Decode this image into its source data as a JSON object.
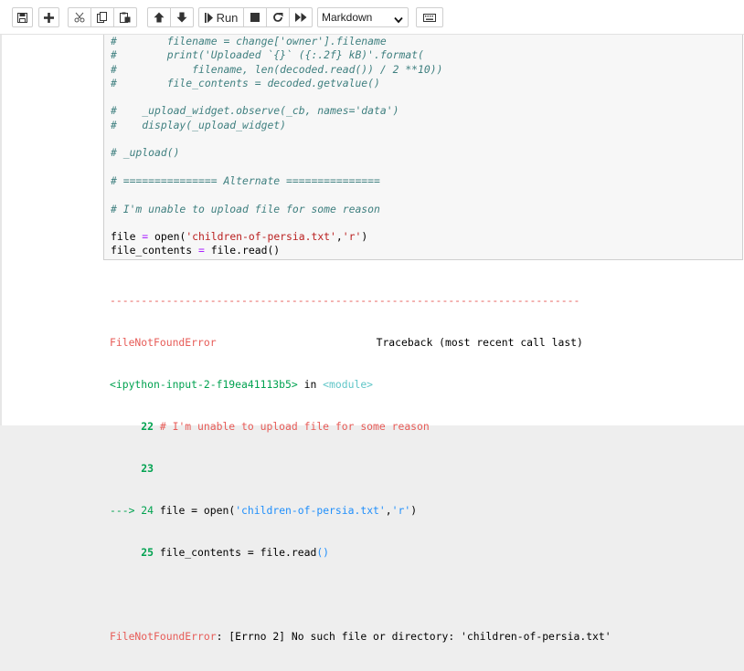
{
  "toolbar": {
    "run_label": "Run",
    "cell_type_value": "Markdown"
  },
  "code_lines": [
    {
      "type": "comment",
      "text": "#        filename = change['owner'].filename"
    },
    {
      "type": "comment",
      "text": "#        print('Uploaded `{}` ({:.2f} kB)'.format("
    },
    {
      "type": "comment",
      "text": "#            filename, len(decoded.read()) / 2 **10))"
    },
    {
      "type": "comment",
      "text": "#        file_contents = decoded.getvalue()"
    },
    {
      "type": "blank",
      "text": ""
    },
    {
      "type": "comment",
      "text": "#    _upload_widget.observe(_cb, names='data')"
    },
    {
      "type": "comment",
      "text": "#    display(_upload_widget)"
    },
    {
      "type": "blank",
      "text": ""
    },
    {
      "type": "comment",
      "text": "# _upload()"
    },
    {
      "type": "blank",
      "text": ""
    },
    {
      "type": "comment",
      "text": "# =============== Alternate ==============="
    },
    {
      "type": "blank",
      "text": ""
    },
    {
      "type": "comment",
      "text": "# I'm unable to upload file for some reason"
    },
    {
      "type": "blank",
      "text": ""
    },
    {
      "type": "code1",
      "parts": [
        "file ",
        "=",
        " open(",
        "'children-of-persia.txt'",
        ",",
        "'r'",
        ")"
      ]
    },
    {
      "type": "code2",
      "parts": [
        "file_contents ",
        "=",
        " file.read()"
      ]
    }
  ],
  "traceback": {
    "dashes": "---------------------------------------------------------------------------",
    "error_name": "FileNotFoundError",
    "traceback_label": "Traceback (most recent call last)",
    "input_ref": "<ipython-input-2-f19ea41113b5>",
    "in_text": " in ",
    "module_text": "<module>",
    "line22_num": "22",
    "line22_text": "# I'm unable to upload file for some reason",
    "line23_num": "23",
    "arrow": "--->",
    "line24_num": "24",
    "line24_pre": "file ",
    "line24_eq": "=",
    "line24_open": " open(",
    "line24_str1": "'children-of-persia.txt'",
    "line24_comma": ",",
    "line24_str2": "'r'",
    "line24_close": ")",
    "line25_num": "25",
    "line25_pre": "file_contents ",
    "line25_eq": "=",
    "line25_post": " file.read",
    "line25_parens": "()",
    "final_error_name": "FileNotFoundError",
    "final_error_msg": ": [Errno 2] No such file or directory: 'children-of-persia.txt'"
  },
  "icons": [
    "save-icon",
    "add-cell-icon",
    "cut-icon",
    "copy-icon",
    "paste-icon",
    "move-up-icon",
    "move-down-icon",
    "run-icon",
    "stop-icon",
    "restart-icon",
    "fast-forward-icon",
    "chevron-down-icon",
    "keyboard-icon"
  ]
}
